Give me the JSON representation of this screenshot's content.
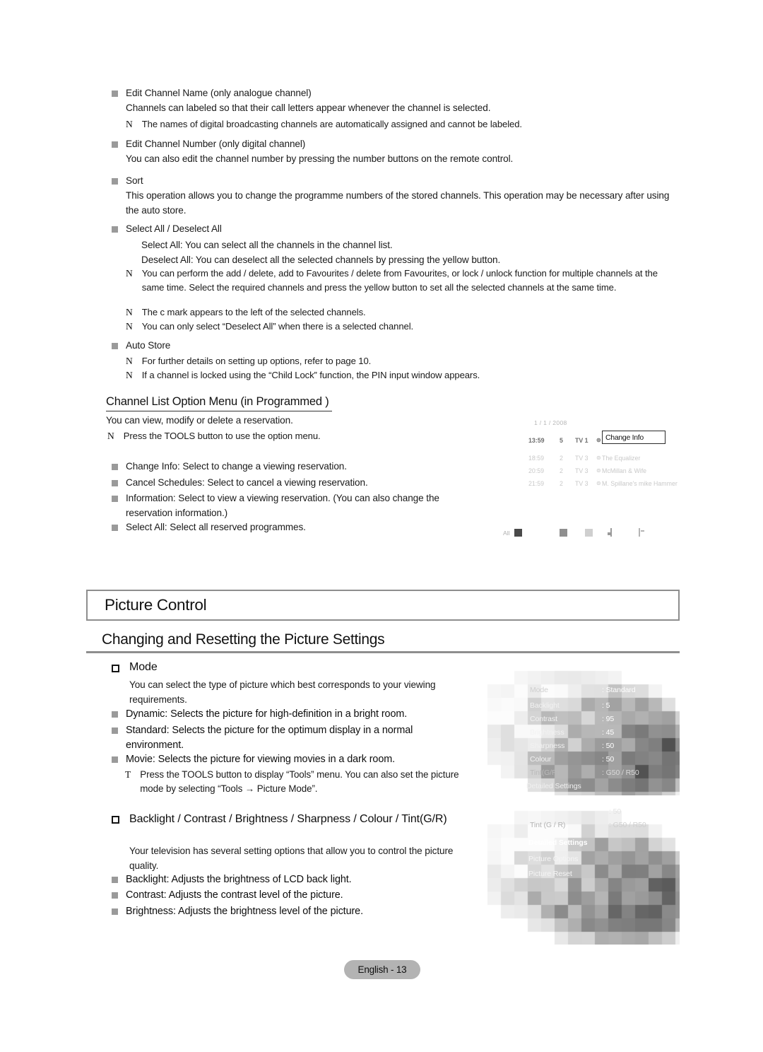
{
  "document": {
    "page_label": "English - 13"
  },
  "top_section": {
    "items": [
      {
        "marker": "square",
        "heading": "Edit Channel Name (only analogue channel)",
        "body": "Channels can labeled so that their call letters appear whenever the channel is selected.",
        "notes": [
          "The names of digital broadcasting channels are automatically assigned and cannot be labeled."
        ]
      },
      {
        "marker": "square",
        "heading": "Edit Channel Number (only digital channel)",
        "body": "You can also edit the channel number by pressing the number buttons on the remote control.",
        "notes": []
      },
      {
        "marker": "square",
        "heading": "Sort",
        "body": "This operation allows you to change the programme numbers of the stored channels. This operation may be necessary after using the auto store.",
        "notes": []
      },
      {
        "marker": "square",
        "heading": "Select All / Deselect All",
        "sub_lines": [
          "Select All: You can select all the channels in the channel list.",
          "Deselect All: You can deselect all the selected channels by pressing the yellow button."
        ],
        "notes": [
          "You can perform the add / delete, add to Favourites / delete from Favourites, or lock / unlock function for multiple channels at the same time. Select the required channels and press the yellow button to set all the selected channels at the same time.",
          "The c mark appears to the left of the selected channels.",
          "You can only select “Deselect All” when there is a selected channel."
        ]
      },
      {
        "marker": "square",
        "heading": "Auto Store",
        "notes": [
          "For further details on setting up options, refer to page 10.",
          "If a channel is locked using the “Child Lock” function, the PIN input window appears."
        ]
      }
    ]
  },
  "channel_list_option_menu": {
    "heading": "Channel List Option Menu (in Programmed )",
    "intro": "You can view, modify or delete a reservation.",
    "note": "Press the TOOLS button to use the option menu.",
    "bullets": [
      "Change Info: Select to change a viewing reservation.",
      "Cancel Schedules: Select to cancel a viewing reservation.",
      "Information: Select to view a viewing reservation. (You can also change the reservation information.)",
      "Select All: Select all reserved programmes."
    ]
  },
  "tv_schedule": {
    "date": "1 / 1 / 2008",
    "popup_label": "Change Info",
    "rows": [
      {
        "time": "13:59",
        "num": "5",
        "channel": "TV 1",
        "dot": "⊚",
        "name": "C",
        "state": "active"
      },
      {
        "time": "18:59",
        "num": "2",
        "channel": "TV 3",
        "dot": "⊚",
        "name": "The Equalizer",
        "state": "dim"
      },
      {
        "time": "20:59",
        "num": "2",
        "channel": "TV 3",
        "dot": "⊚",
        "name": "McMillan & Wife",
        "state": "dim"
      },
      {
        "time": "21:59",
        "num": "2",
        "channel": "TV 3",
        "dot": "⊚",
        "name": "M. Spillane's mike Hammer",
        "state": "dim"
      }
    ],
    "footer_label": "All"
  },
  "picture_control": {
    "chapter_title": "Picture Control",
    "section_title": "Changing and Resetting the Picture Settings",
    "mode": {
      "heading": "Mode",
      "body": "You can select the type of picture which best corresponds to your viewing requirements.",
      "bullets": [
        "Dynamic: Selects the picture for high-definition in a bright room.",
        "Standard: Selects the picture for the optimum display in a normal environment.",
        "Movie: Selects the picture for viewing movies in a dark room."
      ],
      "tool_note": "Press the TOOLS button to display “Tools” menu. You can also set the picture mode by selecting “Tools → Picture Mode”."
    },
    "adjust": {
      "heading": "Backlight / Contrast / Brightness / Sharpness / Colour / Tint(G/R)",
      "body": "Your television has several setting options that allow you to control the picture quality.",
      "bullets": [
        "Backlight: Adjusts the brightness of LCD back light.",
        "Contrast: Adjusts the contrast level of the picture.",
        "Brightness: Adjusts the brightness level of the picture."
      ]
    }
  },
  "tv_menu_top": {
    "rows": [
      {
        "label": "Mode",
        "value": ": Standard"
      },
      {
        "label": "Backlight",
        "value": ": 5"
      },
      {
        "label": "Contrast",
        "value": ": 95"
      },
      {
        "label": "Brightness",
        "value": ": 45"
      },
      {
        "label": "Sharpness",
        "value": ": 50"
      },
      {
        "label": "Colour",
        "value": ": 50"
      },
      {
        "label": "Tint(G/R)",
        "value": ": G50 / R50"
      },
      {
        "label": "Detailed Settings",
        "value": ""
      }
    ]
  },
  "tv_menu_bottom": {
    "rows": [
      {
        "label": "",
        "value": ": 50"
      },
      {
        "label": "Tint (G / R)",
        "value": ": G50 / R50"
      },
      {
        "label": "Detailed Settings",
        "value": ""
      },
      {
        "label": "Picture Options",
        "value": ""
      },
      {
        "label": "Picture Reset",
        "value": ""
      }
    ]
  }
}
